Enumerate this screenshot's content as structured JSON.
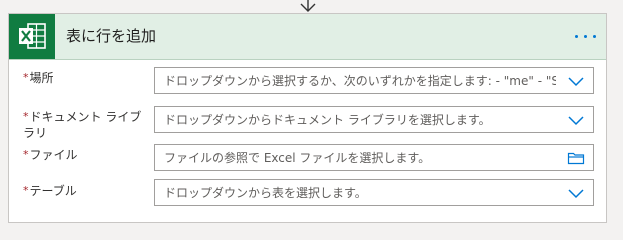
{
  "card": {
    "title": "表に行を追加",
    "app_icon": "excel-icon",
    "more_icon": "more-dots-icon",
    "accent_color": "#0078d4",
    "brand_color": "#107c41",
    "header_bg": "#e1efe5"
  },
  "fields": [
    {
      "required_mark": "*",
      "label": "場所",
      "placeholder": "ドロップダウンから選択するか、次のいずれかを指定します: - \"me\" - \"S",
      "icon": "chevron-down-icon"
    },
    {
      "required_mark": "*",
      "label": "ドキュメント ライブラリ",
      "placeholder": "ドロップダウンからドキュメント ライブラリを選択します。",
      "icon": "chevron-down-icon"
    },
    {
      "required_mark": "*",
      "label": "ファイル",
      "placeholder": "ファイルの参照で Excel ファイルを選択します。",
      "icon": "folder-icon"
    },
    {
      "required_mark": "*",
      "label": "テーブル",
      "placeholder": "ドロップダウンから表を選択します。",
      "icon": "chevron-down-icon"
    }
  ]
}
